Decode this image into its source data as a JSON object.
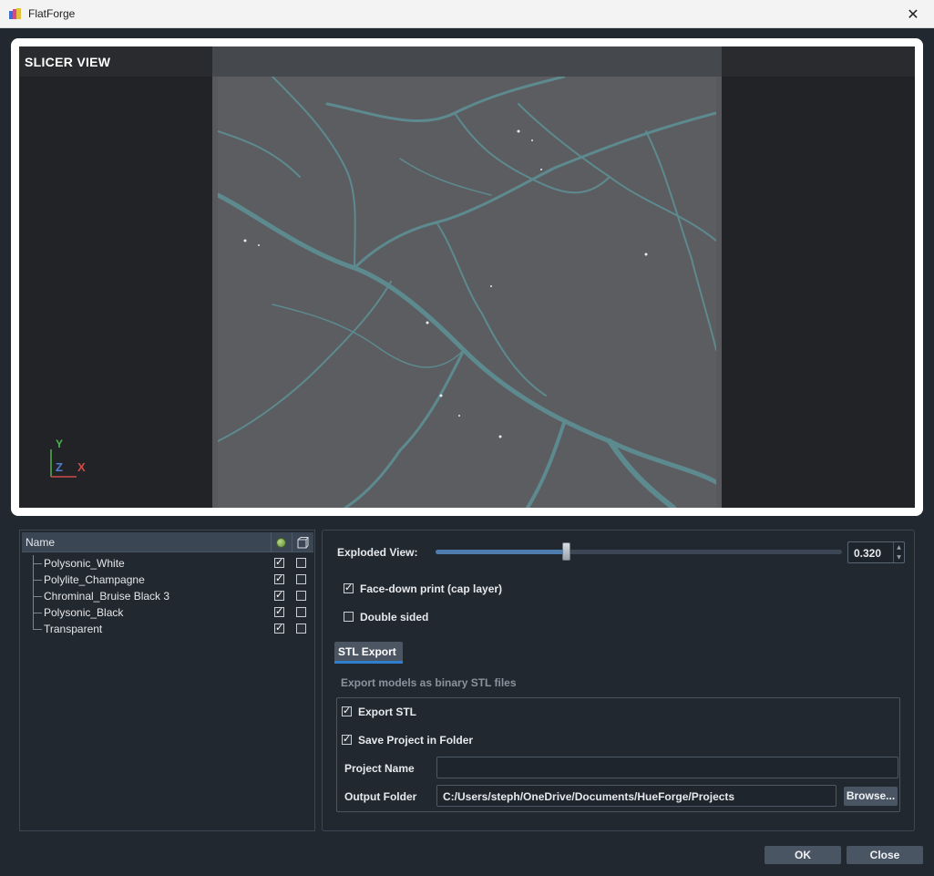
{
  "window": {
    "title": "FlatForge",
    "close_glyph": "✕"
  },
  "viewport": {
    "label": "SLICER VIEW",
    "axis_y": "Y",
    "axis_z": "Z",
    "axis_x": "X"
  },
  "tree": {
    "header_name": "Name",
    "rows": [
      {
        "name": "Polysonic_White",
        "visible": true,
        "other": false
      },
      {
        "name": "Polylite_Champagne",
        "visible": true,
        "other": false
      },
      {
        "name": "Chrominal_Bruise Black 3",
        "visible": true,
        "other": false
      },
      {
        "name": "Polysonic_Black",
        "visible": true,
        "other": false
      },
      {
        "name": "Transparent",
        "visible": true,
        "other": false
      }
    ]
  },
  "settings": {
    "exploded_label": "Exploded View:",
    "exploded_value": "0.320",
    "exploded_fraction": 0.32,
    "face_down_label": "Face-down print (cap layer)",
    "face_down_checked": true,
    "double_sided_label": "Double sided",
    "double_sided_checked": false,
    "tab_label": "STL Export",
    "export_desc": "Export models as binary STL files",
    "export_stl_label": "Export STL",
    "export_stl_checked": true,
    "save_project_label": "Save Project in Folder",
    "save_project_checked": true,
    "project_name_label": "Project Name",
    "project_name_value": "",
    "output_folder_label": "Output Folder",
    "output_folder_value": "C:/Users/steph/OneDrive/Documents/HueForge/Projects",
    "browse_label": "Browse..."
  },
  "buttons": {
    "ok": "OK",
    "close": "Close"
  },
  "colors": {
    "accent": "#2f7fd1",
    "vein": "#5d8a8f",
    "bed": "#5c5d60"
  }
}
